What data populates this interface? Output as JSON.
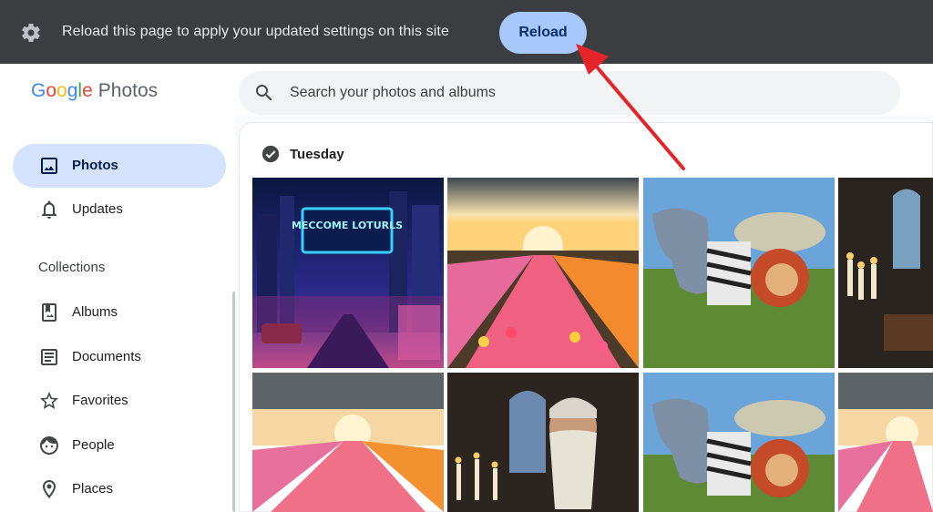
{
  "banner": {
    "message": "Reload this page to apply your updated settings on this site",
    "reload_label": "Reload"
  },
  "logo": {
    "letters": [
      "G",
      "o",
      "o",
      "g",
      "l",
      "e"
    ],
    "product": "Photos"
  },
  "search": {
    "placeholder": "Search your photos and albums"
  },
  "sidebar": {
    "items": [
      {
        "label": "Photos",
        "icon": "photo-icon",
        "active": true
      },
      {
        "label": "Updates",
        "icon": "bell-icon",
        "active": false
      }
    ],
    "collections_title": "Collections",
    "collections": [
      {
        "label": "Albums",
        "icon": "album-icon"
      },
      {
        "label": "Documents",
        "icon": "document-icon"
      },
      {
        "label": "Favorites",
        "icon": "star-icon"
      },
      {
        "label": "People",
        "icon": "face-icon"
      },
      {
        "label": "Places",
        "icon": "pin-icon"
      }
    ]
  },
  "main": {
    "date_label": "Tuesday",
    "photos": [
      {
        "subject": "neon-city",
        "sign_text": "MECCOME LOTURLS"
      },
      {
        "subject": "tulip-field"
      },
      {
        "subject": "elephant-zebra-lion"
      },
      {
        "subject": "candle-hall"
      },
      {
        "subject": "tulip-field"
      },
      {
        "subject": "old-wizard"
      },
      {
        "subject": "elephant-zebra-lion"
      },
      {
        "subject": "tulip-field"
      }
    ]
  },
  "colors": {
    "banner_bg": "#3c3d40",
    "reload_bg": "#a8c7fa",
    "active_nav": "#d3e3fd",
    "annotation_arrow": "#e5242a"
  }
}
